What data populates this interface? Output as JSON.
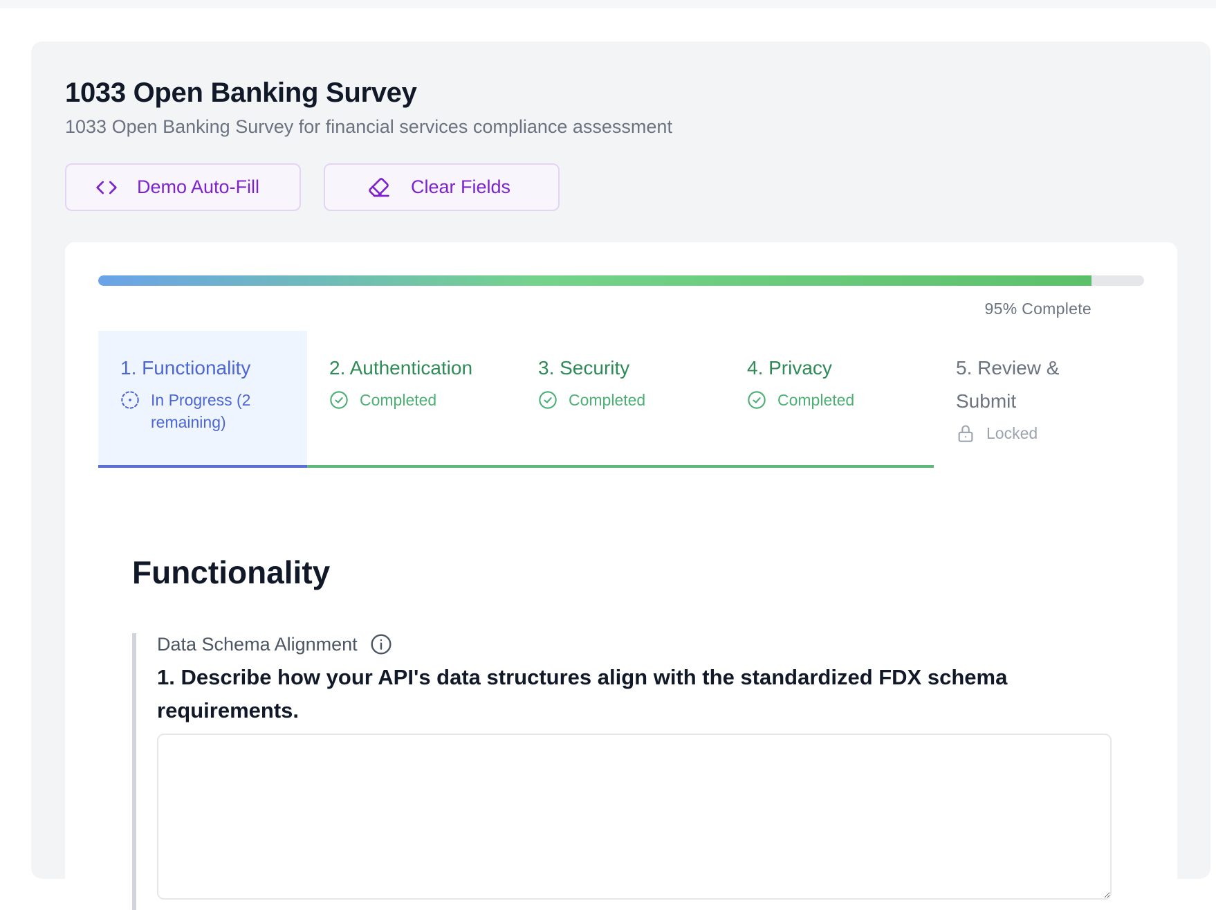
{
  "survey": {
    "title": "1033 Open Banking Survey",
    "subtitle": "1033 Open Banking Survey for financial services compliance assessment"
  },
  "toolbar": {
    "autofill_label": "Demo Auto-Fill",
    "autofill_icon": "code-icon",
    "clear_label": "Clear Fields",
    "clear_icon": "eraser-icon"
  },
  "progress": {
    "percent": 95,
    "label": "95% Complete"
  },
  "tabs": [
    {
      "name": "1. Functionality",
      "status": "In Progress (2 remaining)",
      "state": "in-progress",
      "icon": "progress-circle-icon"
    },
    {
      "name": "2. Authentication",
      "status": "Completed",
      "state": "completed",
      "icon": "check-circle-icon"
    },
    {
      "name": "3. Security",
      "status": "Completed",
      "state": "completed",
      "icon": "check-circle-icon"
    },
    {
      "name": "4. Privacy",
      "status": "Completed",
      "state": "completed",
      "icon": "check-circle-icon"
    },
    {
      "name": "5. Review & Submit",
      "status": "Locked",
      "state": "locked",
      "icon": "lock-icon"
    }
  ],
  "section": {
    "title": "Functionality",
    "question": {
      "topic": "Data Schema Alignment",
      "text": "1. Describe how your API's data structures align with the standardized FDX schema requirements.",
      "answer_value": ""
    }
  },
  "colors": {
    "accent_purple": "#7e22ce",
    "active_blue": "#4d66d1",
    "complete_green": "#4caf73",
    "locked_gray": "#9ca3af"
  }
}
